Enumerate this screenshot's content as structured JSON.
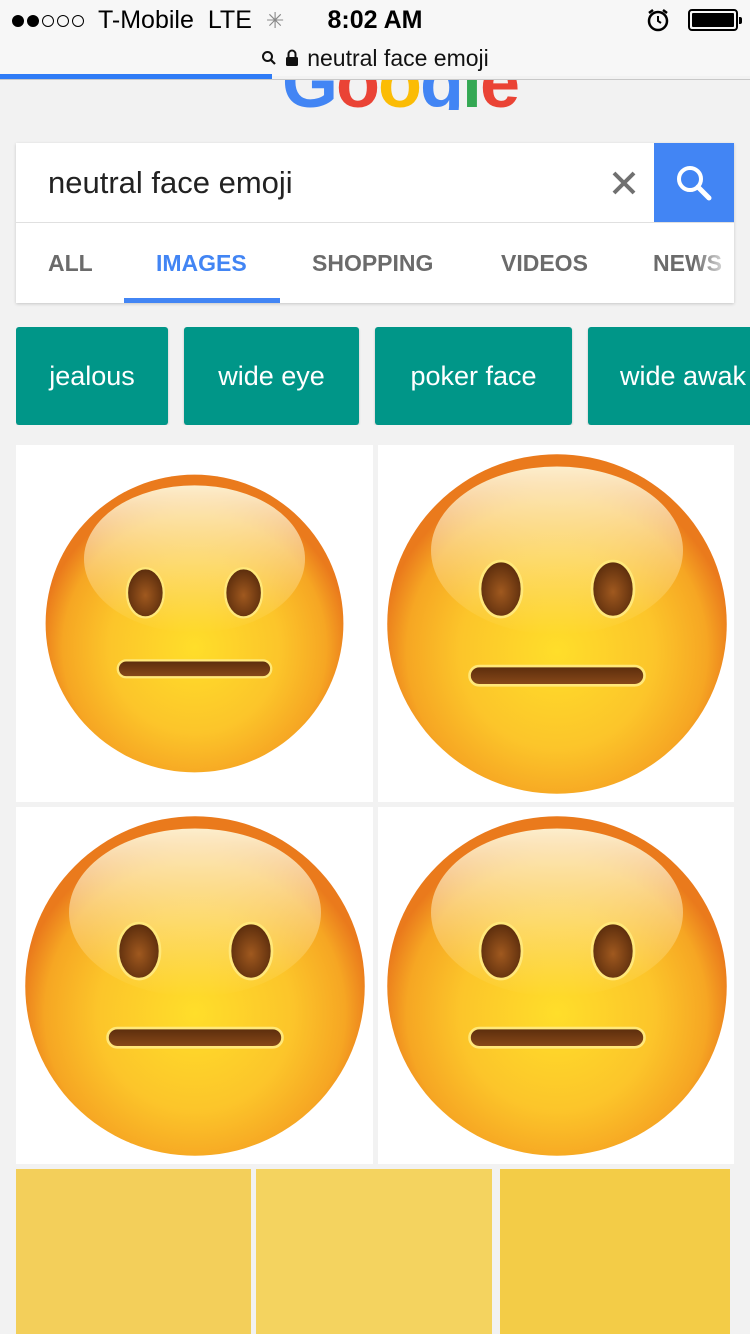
{
  "status": {
    "carrier": "T-Mobile",
    "network": "LTE",
    "time": "8:02 AM",
    "signal_filled": 2,
    "signal_total": 5
  },
  "url": {
    "text": "neutral face emoji"
  },
  "search": {
    "query": "neutral face emoji",
    "tabs": [
      "ALL",
      "IMAGES",
      "SHOPPING",
      "VIDEOS",
      "NEWS"
    ],
    "active_tab": "IMAGES"
  },
  "chips": [
    "jealous",
    "wide eye",
    "poker face",
    "wide awak"
  ],
  "results": {
    "thumbnail_subject": "neutral face emoji",
    "tile_colors": [
      "#f3cf5a",
      "#f4d35f",
      "#f3cc47"
    ]
  },
  "colors": {
    "accent": "#4285f4",
    "chip": "#009688"
  },
  "icons": [
    "search-icon",
    "lock-icon",
    "alarm-icon",
    "battery-icon",
    "close-icon",
    "loading-spinner-icon"
  ]
}
